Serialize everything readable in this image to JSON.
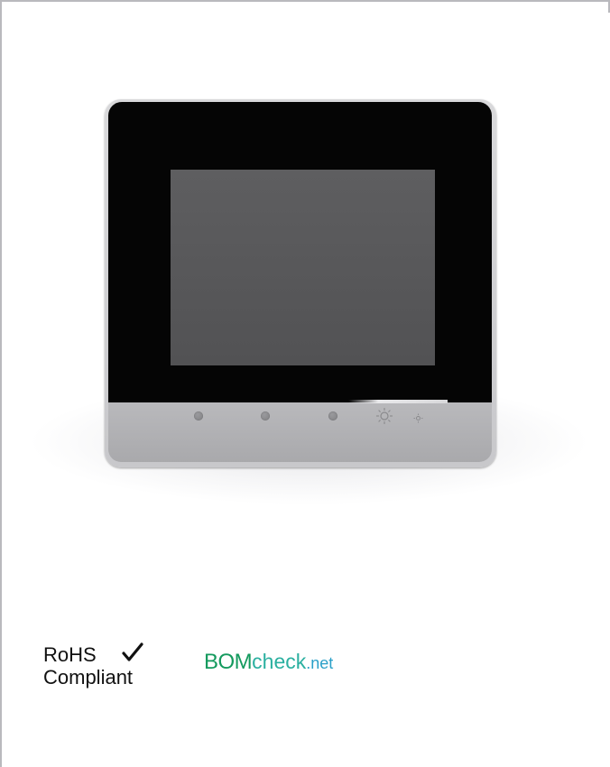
{
  "rohs": {
    "line1": "RoHS",
    "line2": "Compliant",
    "check_icon": "checkmark-icon"
  },
  "bomcheck": {
    "part1": "BOM",
    "part2": "check",
    "part3": ".net",
    "colors": {
      "bom": "#149a5e",
      "check": "#2bb0a0",
      "net": "#2aa0c8"
    }
  },
  "device": {
    "buttons": [
      "round-key-1",
      "round-key-2",
      "round-key-3"
    ],
    "icons": [
      "brightness-up-icon",
      "brightness-down-icon"
    ],
    "colors": {
      "bezel": "#050505",
      "screen": "#555557",
      "bar": "#b1b1b4"
    }
  }
}
